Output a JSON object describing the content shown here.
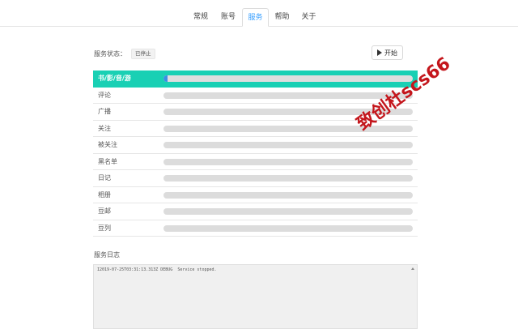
{
  "tabs": [
    {
      "label": "常规",
      "active": false
    },
    {
      "label": "账号",
      "active": false
    },
    {
      "label": "服务",
      "active": true
    },
    {
      "label": "帮助",
      "active": false
    },
    {
      "label": "关于",
      "active": false
    }
  ],
  "status": {
    "label": "服务状态：",
    "value": "已停止"
  },
  "start_button": {
    "label": "开始",
    "icon": "play-icon"
  },
  "services": [
    {
      "name": "书/影/音/游",
      "selected": true,
      "progress": 0.015
    },
    {
      "name": "评论",
      "selected": false,
      "progress": 0
    },
    {
      "name": "广播",
      "selected": false,
      "progress": 0
    },
    {
      "name": "关注",
      "selected": false,
      "progress": 0
    },
    {
      "name": "被关注",
      "selected": false,
      "progress": 0
    },
    {
      "name": "黑名单",
      "selected": false,
      "progress": 0
    },
    {
      "name": "日记",
      "selected": false,
      "progress": 0
    },
    {
      "name": "相册",
      "selected": false,
      "progress": 0
    },
    {
      "name": "豆邮",
      "selected": false,
      "progress": 0
    },
    {
      "name": "豆列",
      "selected": false,
      "progress": 0
    }
  ],
  "log": {
    "title": "服务日志",
    "lines": [
      "I2019-07-25T03:31:13.313Z DEBUG  Service stopped."
    ]
  },
  "watermark": "致创杜scs66",
  "colors": {
    "selected_row": "#19d0b4",
    "progress_fill": "#3a8ee6",
    "active_tab": "#3aa0ff",
    "watermark": "#c4161c"
  }
}
